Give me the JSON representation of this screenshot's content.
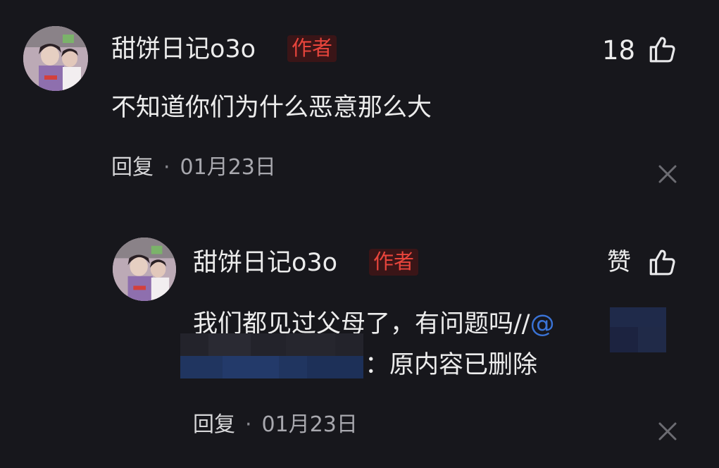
{
  "comment": {
    "username": "甜饼日记o3o",
    "badge": "作者",
    "text": "不知道你们为什么恶意那么大",
    "like_count": "18",
    "reply_label": "回复",
    "separator": "·",
    "date": "01月23日"
  },
  "reply": {
    "username": "甜饼日记o3o",
    "badge": "作者",
    "text_line1": "我们都见过父母了，有问题吗//",
    "mention": "@",
    "text_line2": "：原内容已删除",
    "like_label": "赞",
    "reply_label": "回复",
    "separator": "·",
    "date": "01月23日"
  },
  "icons": {
    "like": "thumbs-up-icon",
    "close": "close-icon"
  },
  "colors": {
    "background": "#17171c",
    "badge_text": "#e8453c",
    "badge_bg": "#3a1517",
    "mention": "#3a73d6"
  }
}
